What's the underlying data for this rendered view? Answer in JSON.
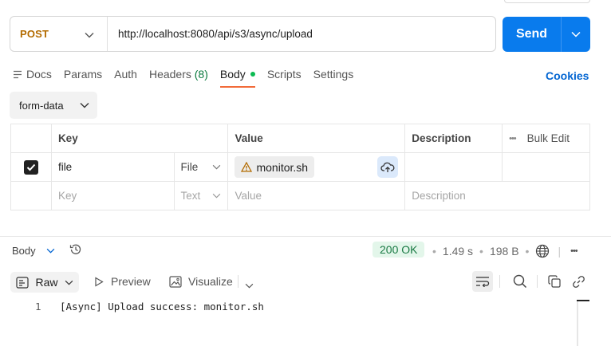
{
  "request": {
    "method": "POST",
    "url": "http://localhost:8080/api/s3/async/upload",
    "send_label": "Send"
  },
  "tabs": {
    "docs": "Docs",
    "params": "Params",
    "auth": "Auth",
    "headers": "Headers",
    "headers_count": "(8)",
    "body": "Body",
    "scripts": "Scripts",
    "settings": "Settings",
    "cookies": "Cookies"
  },
  "body_mode": "form-data",
  "table": {
    "headers": {
      "key": "Key",
      "value": "Value",
      "description": "Description",
      "bulk_edit": "Bulk Edit"
    },
    "rows": [
      {
        "key": "file",
        "type": "File",
        "value": "monitor.sh",
        "description": ""
      }
    ],
    "placeholder": {
      "key": "Key",
      "type": "Text",
      "value": "Value",
      "description": "Description"
    }
  },
  "response": {
    "label": "Body",
    "status": "200 OK",
    "time": "1.49 s",
    "size": "198 B",
    "view_modes": {
      "raw": "Raw",
      "preview": "Preview",
      "visualize": "Visualize"
    },
    "lines": [
      {
        "number": "1",
        "text": "[Async] Upload success: monitor.sh"
      }
    ]
  },
  "colors": {
    "send": "#097BED",
    "method": "#B36B00",
    "active_tab_underline": "#F26B3A",
    "body_dot": "#0CBB52",
    "status_ok": "#1A7A44",
    "link": "#0265D2"
  }
}
